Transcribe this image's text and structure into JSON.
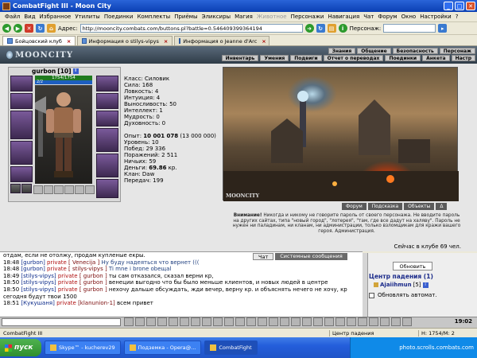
{
  "window": {
    "title": "CombatFight III - Moon City"
  },
  "menu": [
    "Файл",
    "Вид",
    "Избранное",
    "Утилиты",
    "Поединки",
    "Комплекты",
    "Приёмы",
    "Эликсиры",
    "Магия",
    "Животное",
    "Персонажи",
    "Навигация",
    "Чат",
    "Форум",
    "Окно",
    "Настройки",
    "?"
  ],
  "menu_disabled": "Животное",
  "address": {
    "label": "Адрес:",
    "url": "http://mooncity.combats.com/buttons.pl?battle=0.546409399364194",
    "person_label": "Персонаж:"
  },
  "tabs": [
    {
      "label": "Бойцовский клуб",
      "active": true
    },
    {
      "label": "Информация о stilys-vipys",
      "active": false
    },
    {
      "label": "Информация о Jeanne d'Arc",
      "active": false
    }
  ],
  "logo": "MOONCITY",
  "nav_top": [
    "Знания",
    "Общение",
    "Безопасность",
    "Персонаж"
  ],
  "nav_bottom": [
    "Инвентарь",
    "Умения",
    "Подвиги",
    "Отчет о переводах",
    "Поединки",
    "Анкета",
    "Настр"
  ],
  "character": {
    "name": "gurbon",
    "level": "[10]",
    "hp": "1754/1754",
    "mp": "2/2"
  },
  "stats": {
    "class": "Класс: Силовик",
    "strength": "Сила: 168",
    "agility": "Ловкость: 4",
    "intuition": "Интуиция: 4",
    "endurance": "Выносливость: 50",
    "intellect": "Интеллект: 1",
    "wisdom": "Мудрость: 0",
    "spirit": "Духовность: 0",
    "exp_label": "Опыт: ",
    "exp_value": "10 001 078",
    "exp_next": " (13 000 000)",
    "level": "Уровень: 10",
    "wins": "Побед: 29 336",
    "losses": "Поражений: 2 511",
    "draws": "Ничьих: 59",
    "money_label": "Деньги: ",
    "money_value": "69.86",
    "money_unit": " кр.",
    "clan": "Клан: Daw",
    "transfers": "Передач: 199"
  },
  "scene": {
    "label": "MOONCITY",
    "buttons": [
      "Форум",
      "Подсказка",
      "Объекты",
      "Δ"
    ]
  },
  "warning": {
    "strong": "Внимание!",
    "text": "Никогда и никому не говорите пароль от своего персонажа. Не вводите пароль на других сайтах, типа \"новый город\", \"лотерея\", \"там, где все дадут на халяву\". Пароль не нужен ни паладинам, ни кланам, ни администрации, только взломщикам для кражи вашего героя.",
    "sign": "Администрация."
  },
  "online": "Сейчас в клубе 69 чел.",
  "chat_tabs": [
    "Чат",
    "Системные сообщения"
  ],
  "chat_lines": [
    {
      "ts": "",
      "from": "",
      "type": "",
      "to": "",
      "text": "отдам, если не отолжу, продам купленые екры."
    },
    {
      "ts": "18:48",
      "from": "[gurbon]",
      "type": "private",
      "to": "[ Venecija ]",
      "text": "Ну буду надеяться что вернет ((("
    },
    {
      "ts": "18:48",
      "from": "[gurbon]",
      "type": "private",
      "to": "[ stilys-vipys ]",
      "text": "Ti mne i brone obeщal"
    },
    {
      "ts": "18:49",
      "from": "[stilys-vipys]",
      "type": "private",
      "to": "[ gurbon ]",
      "text": "ты сам отказался, сказал верни кр,"
    },
    {
      "ts": "18:50",
      "from": "[stilys-vipys]",
      "type": "private",
      "to": "[ gurbon ]",
      "text": "венеции выгодно что бы было меньше клиентов, и новых людей в центре"
    },
    {
      "ts": "18:50",
      "from": "[stilys-vipys]",
      "type": "private",
      "to": "[ gurbon ]",
      "text": "нехочу дальше обсуждать, жди вечер, верну кр. и объяснять нечего не хочу, кр сегодня будут твои 1500"
    },
    {
      "ts": "18:51",
      "from": "[Кукушаня]",
      "type": "private",
      "to": "[klanunion-1]",
      "text": "всем привет"
    }
  ],
  "right_panel": {
    "refresh": "Обновить",
    "center_title": "Центр падения (1)",
    "user": "Ajaiihmun",
    "user_level": "[5]",
    "auto_refresh": "Обновлять автомат."
  },
  "clock": "19:02",
  "status": {
    "left": "CombatFight III",
    "mid": "Центр падения",
    "right": "H: 1754/M: 2"
  },
  "taskbar": {
    "start": "пуск",
    "tasks": [
      "Skype™ - kucherev29",
      "Подземка - Opera@...",
      "CombatFight"
    ],
    "tray_text": "photo.scrolls.combats.com"
  }
}
